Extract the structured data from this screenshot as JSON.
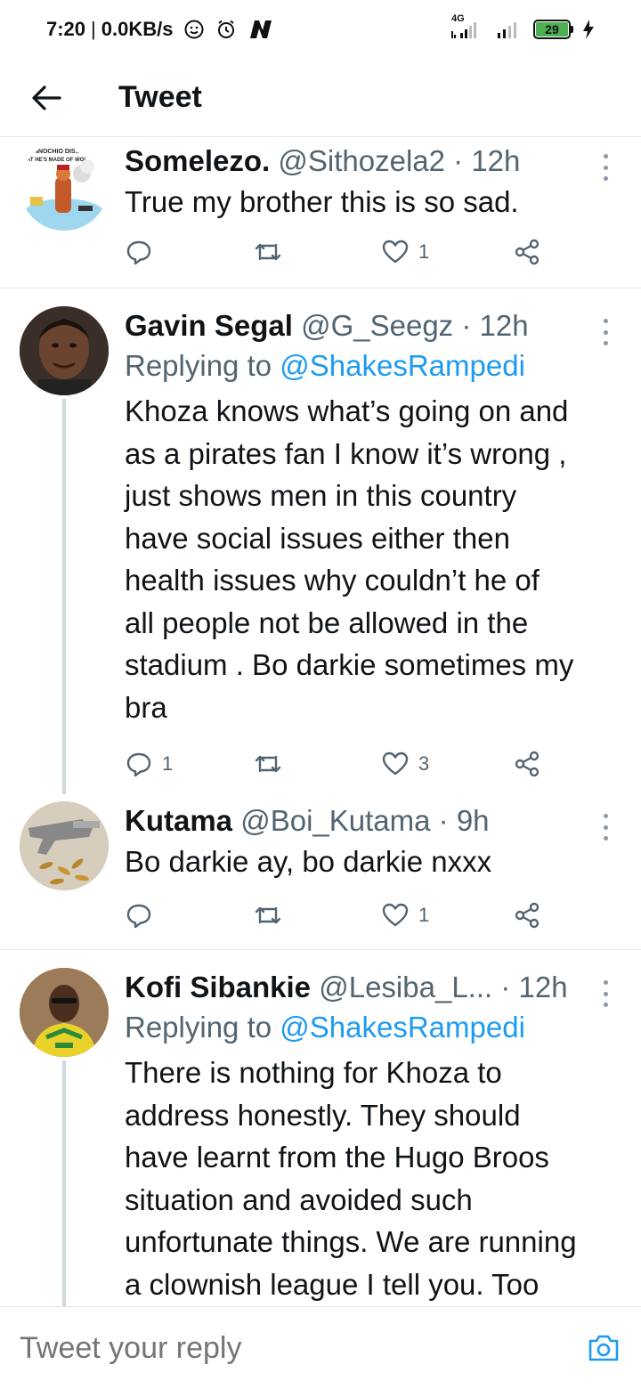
{
  "status_bar": {
    "time": "7:20",
    "speed": "0.0KB/s",
    "network": "4G",
    "battery": "29"
  },
  "header": {
    "title": "Tweet"
  },
  "tweets": [
    {
      "name": "Somelezo.",
      "handle": "@Sithozela2",
      "time": "12h",
      "avatar_text": [
        "..INNOCHIO DIS..",
        "AT HE'S MADE OF WOL"
      ],
      "replying_to": "",
      "lines": [
        "True my brother this is so sad."
      ],
      "reply_count": "",
      "retweet_count": "",
      "like_count": "1"
    },
    {
      "name": "Gavin Segal",
      "handle": "@G_Seegz",
      "time": "12h",
      "replying_prefix": "Replying to",
      "replying_to": "@ShakesRampedi",
      "lines": [
        "Khoza knows what’s going on and",
        "as a pirates fan I know it’s wrong ,",
        "just shows men in this country",
        "have social issues either then",
        "health issues why couldn’t he of",
        "all people not be allowed in the",
        "stadium . Bo darkie sometimes my",
        "bra"
      ],
      "reply_count": "1",
      "retweet_count": "",
      "like_count": "3"
    },
    {
      "name": "Kutama",
      "handle": "@Boi_Kutama",
      "time": "9h",
      "lines": [
        "Bo darkie ay, bo darkie nxxx"
      ],
      "reply_count": "",
      "retweet_count": "",
      "like_count": "1"
    },
    {
      "name": "Kofi Sibankie",
      "handle": "@Lesiba_L...",
      "time": "12h",
      "replying_prefix": "Replying to",
      "replying_to": "@ShakesRampedi",
      "lines": [
        "There is nothing for Khoza to",
        "address honestly. They should",
        "have learnt from the Hugo Broos",
        "situation and avoided such",
        "unfortunate things. We are running",
        "a clownish league I tell you. Too"
      ]
    }
  ],
  "reply_bar": {
    "placeholder": "Tweet your reply"
  },
  "colors": {
    "accent": "#1d9bf0",
    "secondary_text": "#536471",
    "battery": "#4caf50"
  }
}
